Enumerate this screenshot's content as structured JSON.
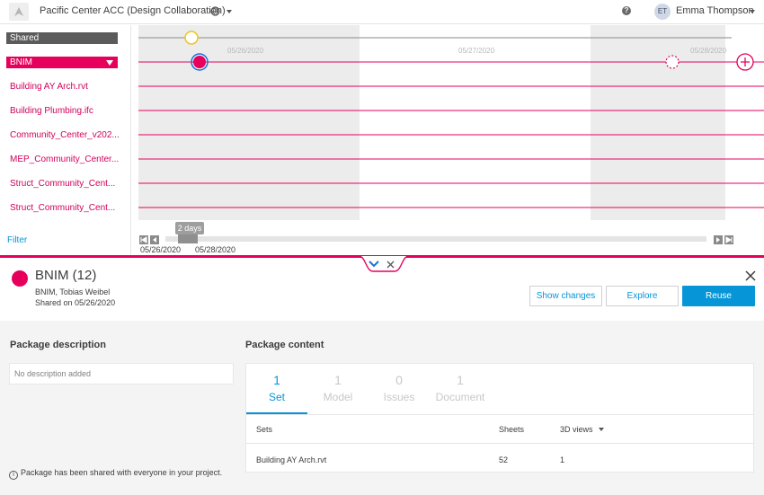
{
  "header": {
    "project_title": "Pacific Center ACC (Design Collaboration)",
    "help_glyph": "?",
    "user_initials": "ET",
    "user_name": "Emma Thompson"
  },
  "sidebar": {
    "shared_label": "Shared",
    "company_label": "BNIM",
    "files": [
      "Building AY Arch.rvt",
      "Building Plumbing.ifc",
      "Community_Center_v202...",
      "MEP_Community_Center...",
      "Struct_Community_Cent...",
      "Struct_Community_Cent..."
    ],
    "filter_label": "Filter"
  },
  "timeline": {
    "dates": [
      "05/26/2020",
      "05/27/2020",
      "05/28/2020"
    ],
    "range_badge": "2 days",
    "scroll_start": "05/26/2020",
    "scroll_end": "05/28/2020",
    "accent": "#e6005c"
  },
  "package": {
    "title": "BNIM (12)",
    "members": "BNIM, Tobias Weibel",
    "shared_on": "Shared on 05/26/2020",
    "buttons": {
      "show_changes": "Show changes",
      "explore": "Explore",
      "reuse": "Reuse"
    }
  },
  "description": {
    "title": "Package description",
    "placeholder": "No description added",
    "info_glyph": "i",
    "info_note": "Package has been shared with everyone in your project."
  },
  "content": {
    "title": "Package content",
    "tabs": [
      {
        "count": "1",
        "label": "Set"
      },
      {
        "count": "1",
        "label": "Model"
      },
      {
        "count": "0",
        "label": "Issues"
      },
      {
        "count": "1",
        "label": "Document"
      }
    ],
    "columns": {
      "sets": "Sets",
      "sheets": "Sheets",
      "views": "3D views"
    },
    "rows": [
      {
        "name": "Building AY Arch.rvt",
        "sheets": "52",
        "views": "1"
      }
    ]
  }
}
